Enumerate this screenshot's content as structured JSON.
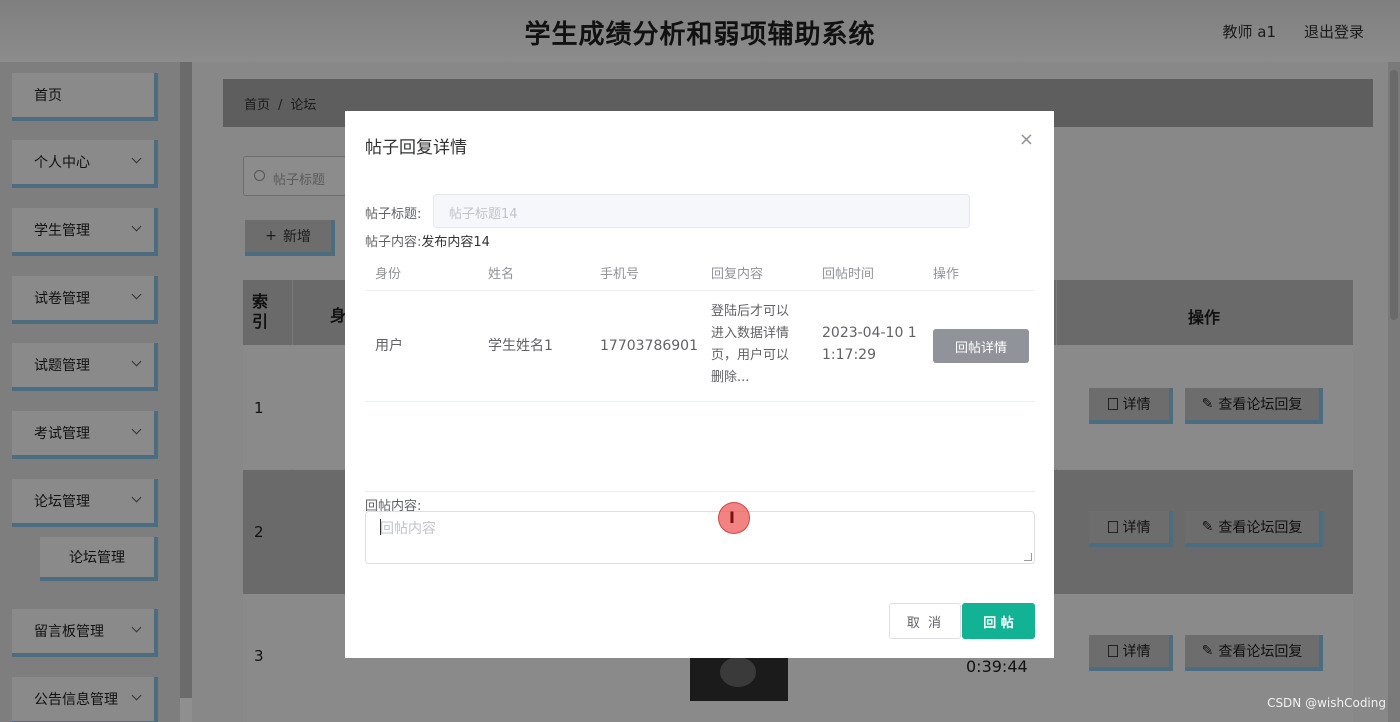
{
  "app": {
    "title": "学生成绩分析和弱项辅助系统",
    "user": "教师 a1",
    "logout": "退出登录"
  },
  "sidebar": {
    "items": [
      {
        "label": "首页"
      },
      {
        "label": "个人中心"
      },
      {
        "label": "学生管理"
      },
      {
        "label": "试卷管理"
      },
      {
        "label": "试题管理"
      },
      {
        "label": "考试管理"
      },
      {
        "label": "论坛管理"
      },
      {
        "label": "论坛管理"
      },
      {
        "label": "留言板管理"
      },
      {
        "label": "公告信息管理"
      }
    ]
  },
  "breadcrumb": {
    "home": "首页",
    "sep": "/",
    "current": "论坛"
  },
  "search": {
    "placeholder": "帖子标题"
  },
  "toolbar": {
    "add_label": "新增"
  },
  "table": {
    "headers": {
      "index": "索引",
      "col2": "身",
      "actions": "操作"
    },
    "rows": [
      {
        "index": "1"
      },
      {
        "index": "2"
      },
      {
        "index": "3",
        "time": "0:39:44"
      }
    ],
    "detail_label": "详情",
    "view_replies_label": "查看论坛回复"
  },
  "modal": {
    "title": "帖子回复详情",
    "close": "×",
    "post_title_label": "帖子标题:",
    "post_title_value": "帖子标题14",
    "post_content_label": "帖子内容:",
    "post_content_value": "发布内容14",
    "reply_table": {
      "headers": [
        "身份",
        "姓名",
        "手机号",
        "回复内容",
        "回帖时间",
        "操作"
      ],
      "rows": [
        {
          "role": "用户",
          "name": "学生姓名1",
          "phone": "17703786901",
          "content": "登陆后才可以进入数据详情页，用户可以删除...",
          "time": "2023-04-10 11:17:29",
          "action": "回帖详情"
        }
      ]
    },
    "reply_label": "回帖内容:",
    "reply_placeholder": "回帖内容",
    "cancel_label": "取 消",
    "submit_label": "回 帖"
  },
  "watermark": "CSDN @wishCoding",
  "colors": {
    "accent": "#12b294",
    "overlay_border": "#4c6d80"
  }
}
